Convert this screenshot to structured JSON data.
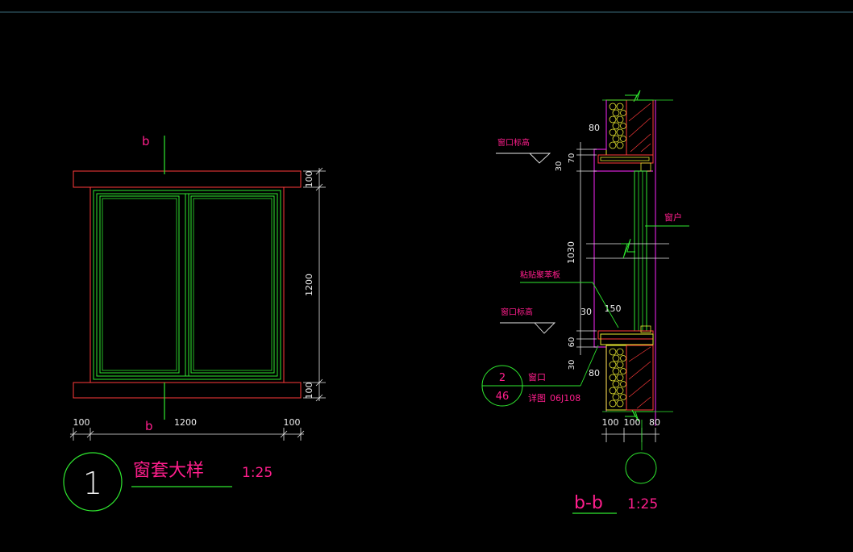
{
  "drawing": {
    "colors": {
      "background": "#000000",
      "outline_red": "#ff3a3a",
      "frame_green": "#2fe82f",
      "wall_magenta": "#d020d0",
      "insulation_yellow": "#e8e830",
      "hatch_red": "#ff3a3a",
      "dim_white": "#e8e8e8",
      "label_magenta": "#ff1e8c",
      "leader_green": "#2fe82f",
      "top_rule": "#3a6a7a"
    },
    "elevation": {
      "section_mark_top": "b",
      "section_mark_bottom": "b",
      "dim_top": "100",
      "dim_height": "1200",
      "dim_bottom": "100",
      "dim_left": "100",
      "dim_width": "1200",
      "dim_right": "100",
      "detail_number": "1",
      "title": "窗套大样",
      "scale": "1:25"
    },
    "section": {
      "dim_80_top": "80",
      "dim_70": "70",
      "dim_30_top": "30",
      "dim_1030": "1030",
      "dim_30_mid": "30",
      "dim_150": "150",
      "dim_60": "60",
      "dim_30_bot": "30",
      "dim_80_bot": "80",
      "dim_b1": "100",
      "dim_b2": "100",
      "dim_b3": "80",
      "label_sill_top": "窗口标高",
      "label_window": "窗户",
      "label_board": "粘贴聚苯板",
      "label_sill_bot": "窗口标高",
      "ref_top": "2",
      "ref_bottom": "46",
      "label_opening": "窗口",
      "label_detail": "详图",
      "label_atlas": "06J108",
      "title": "b-b",
      "scale": "1:25"
    }
  }
}
